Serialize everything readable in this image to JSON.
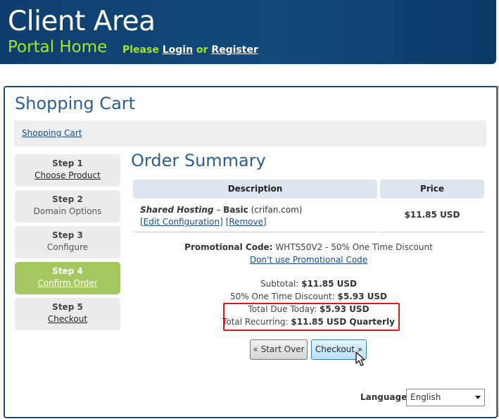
{
  "header": {
    "title": "Client Area",
    "portal_home": "Portal Home",
    "please": "Please",
    "login": "Login",
    "or": "or",
    "register": "Register"
  },
  "page": {
    "title": "Shopping Cart",
    "breadcrumb": "Shopping Cart"
  },
  "steps": [
    {
      "number": "Step 1",
      "label": "Choose Product",
      "link": true
    },
    {
      "number": "Step 2",
      "label": "Domain Options",
      "link": false
    },
    {
      "number": "Step 3",
      "label": "Configure",
      "link": false
    },
    {
      "number": "Step 4",
      "label": "Confirm Order",
      "link": true,
      "active": true
    },
    {
      "number": "Step 5",
      "label": "Checkout",
      "link": true
    }
  ],
  "summary": {
    "title": "Order Summary",
    "col_description": "Description",
    "col_price": "Price",
    "item_product": "Shared Hosting",
    "item_dash": " – ",
    "item_plan": "Basic",
    "item_domain": " (crifan.com)",
    "edit_config": "[Edit Configuration]",
    "remove": "[Remove]",
    "item_price": "$11.85 USD",
    "promo_label": "Promotional Code:",
    "promo_value": "WHTS50V2 - 50% One Time Discount",
    "promo_remove": "Don't use Promotional Code",
    "subtotal_label": "Subtotal:",
    "subtotal_value": "$11.85 USD",
    "discount_label": "50% One Time Discount:",
    "discount_value": "$5.93 USD",
    "due_label": "Total Due Today:",
    "due_value": "$5.93 USD",
    "recurring_label": "Total Recurring:",
    "recurring_value": "$11.85 USD Quarterly"
  },
  "buttons": {
    "start_over": "« Start Over",
    "checkout": "Checkout »"
  },
  "language": {
    "label": "Language:",
    "selected": "English"
  },
  "colors": {
    "header_bg": "#124a7c",
    "accent_green": "#a6e622",
    "active_step": "#a4c760",
    "highlight": "#e01515"
  }
}
